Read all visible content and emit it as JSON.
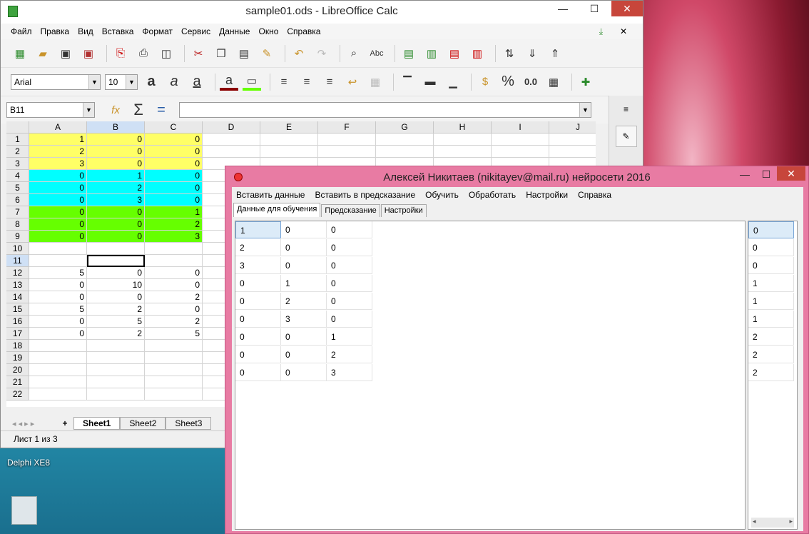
{
  "desktop": {
    "icon1": "Delphi XE8"
  },
  "calc": {
    "title": "sample01.ods - LibreOffice Calc",
    "controls": {
      "minimize": "—",
      "maximize": "☐",
      "close": "✕"
    },
    "menu": [
      "Файл",
      "Правка",
      "Вид",
      "Вставка",
      "Формат",
      "Сервис",
      "Данные",
      "Окно",
      "Справка"
    ],
    "font_name": "Arial",
    "font_size": "10",
    "name_box": "B11",
    "columns": [
      "A",
      "B",
      "C",
      "D",
      "E",
      "F",
      "G",
      "H",
      "I",
      "J"
    ],
    "rows": [
      {
        "n": "1",
        "a": "1",
        "b": "0",
        "c": "0",
        "color": "yellow"
      },
      {
        "n": "2",
        "a": "2",
        "b": "0",
        "c": "0",
        "color": "yellow"
      },
      {
        "n": "3",
        "a": "3",
        "b": "0",
        "c": "0",
        "color": "yellow"
      },
      {
        "n": "4",
        "a": "0",
        "b": "1",
        "c": "0",
        "color": "cyan"
      },
      {
        "n": "5",
        "a": "0",
        "b": "2",
        "c": "0",
        "color": "cyan"
      },
      {
        "n": "6",
        "a": "0",
        "b": "3",
        "c": "0",
        "color": "cyan"
      },
      {
        "n": "7",
        "a": "0",
        "b": "0",
        "c": "1",
        "color": "green"
      },
      {
        "n": "8",
        "a": "0",
        "b": "0",
        "c": "2",
        "color": "green"
      },
      {
        "n": "9",
        "a": "0",
        "b": "0",
        "c": "3",
        "color": "green"
      },
      {
        "n": "10",
        "a": "",
        "b": "",
        "c": "",
        "color": "none"
      },
      {
        "n": "11",
        "a": "",
        "b": "",
        "c": "",
        "color": "none"
      },
      {
        "n": "12",
        "a": "5",
        "b": "0",
        "c": "0",
        "color": "none"
      },
      {
        "n": "13",
        "a": "0",
        "b": "10",
        "c": "0",
        "color": "none"
      },
      {
        "n": "14",
        "a": "0",
        "b": "0",
        "c": "2",
        "color": "none"
      },
      {
        "n": "15",
        "a": "5",
        "b": "2",
        "c": "0",
        "color": "none"
      },
      {
        "n": "16",
        "a": "0",
        "b": "5",
        "c": "2",
        "color": "none"
      },
      {
        "n": "17",
        "a": "0",
        "b": "2",
        "c": "5",
        "color": "none"
      },
      {
        "n": "18",
        "a": "",
        "b": "",
        "c": "",
        "color": "none"
      },
      {
        "n": "19",
        "a": "",
        "b": "",
        "c": "",
        "color": "none"
      },
      {
        "n": "20",
        "a": "",
        "b": "",
        "c": "",
        "color": "none"
      },
      {
        "n": "21",
        "a": "",
        "b": "",
        "c": "",
        "color": "none"
      },
      {
        "n": "22",
        "a": "",
        "b": "",
        "c": "",
        "color": "none"
      }
    ],
    "sheets": [
      "Sheet1",
      "Sheet2",
      "Sheet3"
    ],
    "status": "Лист 1 из 3",
    "colors": {
      "yellow": "#ffff66",
      "cyan": "#00ffff",
      "green": "#66ff00",
      "none": "#ffffff"
    }
  },
  "delphi": {
    "title": "Алексей Никитаев (nikitayev@mail.ru) нейросети 2016",
    "menu": [
      "Вставить данные",
      "Вставить в предсказание",
      "Обучить",
      "Обработать",
      "Настройки",
      "Справка"
    ],
    "tabs": [
      "Данные для обучения",
      "Предсказание",
      "Настройки"
    ],
    "grid": [
      [
        "1",
        "0",
        "0"
      ],
      [
        "2",
        "0",
        "0"
      ],
      [
        "3",
        "0",
        "0"
      ],
      [
        "0",
        "1",
        "0"
      ],
      [
        "0",
        "2",
        "0"
      ],
      [
        "0",
        "3",
        "0"
      ],
      [
        "0",
        "0",
        "1"
      ],
      [
        "0",
        "0",
        "2"
      ],
      [
        "0",
        "0",
        "3"
      ]
    ],
    "output": [
      "0",
      "0",
      "0",
      "1",
      "1",
      "1",
      "2",
      "2",
      "2"
    ]
  }
}
